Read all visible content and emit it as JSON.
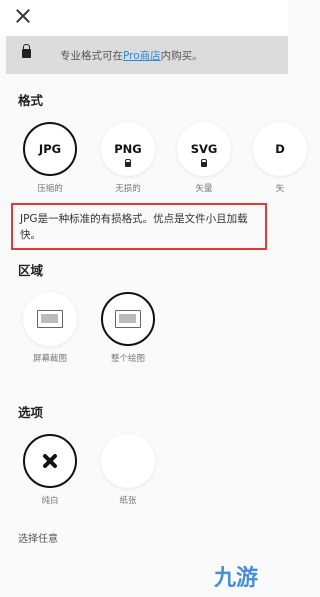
{
  "pro_banner": {
    "prefix": "专业格式可在",
    "link": "Pro商店",
    "suffix": "内购买。"
  },
  "format_section": {
    "title": "格式",
    "items": [
      {
        "label": "JPG",
        "caption": "压缩的",
        "selected": true,
        "locked": false
      },
      {
        "label": "PNG",
        "caption": "无损的",
        "selected": false,
        "locked": true
      },
      {
        "label": "SVG",
        "caption": "矢量",
        "selected": false,
        "locked": true
      },
      {
        "label": "D",
        "caption": "矢",
        "selected": false,
        "locked": false
      }
    ],
    "description": "JPG是一种标准的有损格式。优点是文件小且加载快。"
  },
  "area_section": {
    "title": "区域",
    "items": [
      {
        "caption": "屏幕截图",
        "icon": "screen-icon",
        "selected": false
      },
      {
        "caption": "整个绘图",
        "icon": "canvas-icon",
        "selected": true
      }
    ]
  },
  "options_section": {
    "title": "选项",
    "items": [
      {
        "caption": "纯白",
        "icon": "x-icon",
        "selected": true
      },
      {
        "caption": "纸张",
        "selected": false
      }
    ]
  },
  "footer_text": "选择任意",
  "watermark": "九游"
}
